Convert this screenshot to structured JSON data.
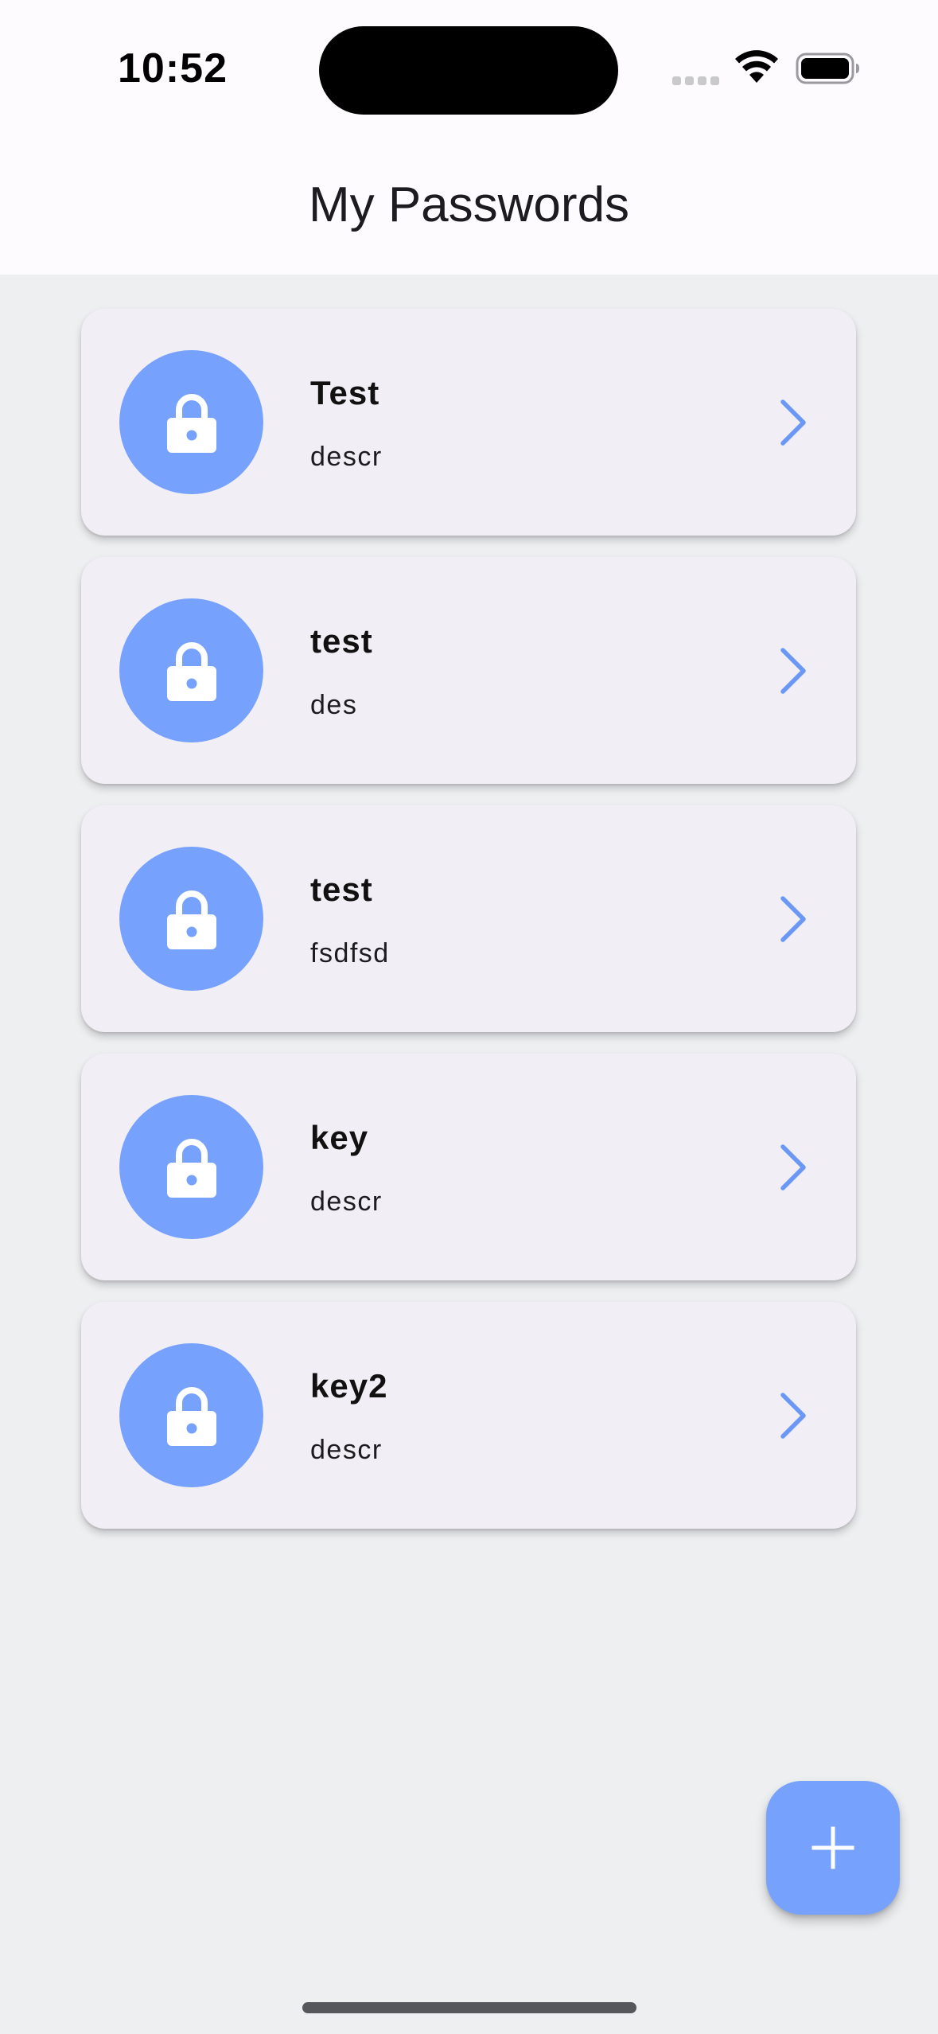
{
  "status_bar": {
    "time": "10:52"
  },
  "header": {
    "title": "My Passwords"
  },
  "passwords": [
    {
      "title": "Test",
      "description": "descr"
    },
    {
      "title": "test",
      "description": "des"
    },
    {
      "title": "test",
      "description": "fsdfsd"
    },
    {
      "title": "key",
      "description": "descr"
    },
    {
      "title": "key2",
      "description": "descr"
    }
  ],
  "icons": {
    "item_icon": "lock-icon",
    "item_action": "chevron-right-icon",
    "fab": "plus-icon"
  },
  "colors": {
    "accent": "#76a2fe",
    "card_background": "#f1eef5",
    "page_background": "#eeeff1",
    "header_background": "#fefbff"
  }
}
